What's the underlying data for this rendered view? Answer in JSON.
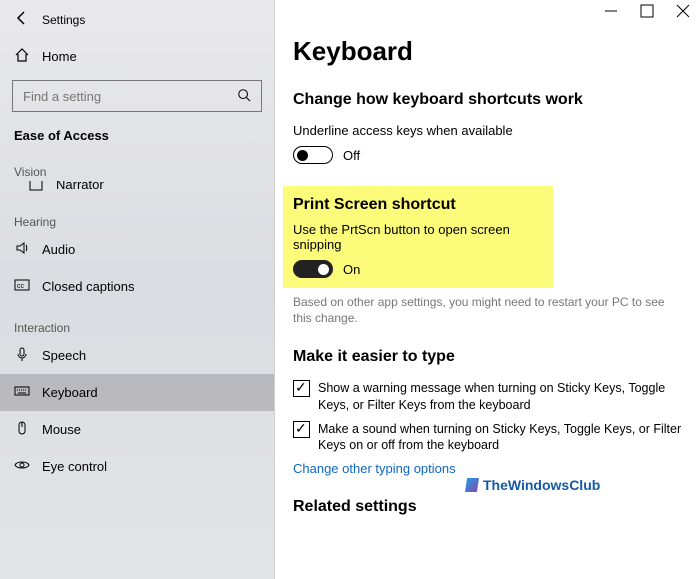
{
  "titlebar": {
    "label": "Settings"
  },
  "sidebar": {
    "home": "Home",
    "search_placeholder": "Find a setting",
    "current_category": "Ease of Access",
    "groups": [
      {
        "label": "Vision",
        "items": [
          {
            "icon": "narrator",
            "label": "Narrator",
            "id": "narrator"
          }
        ]
      },
      {
        "label": "Hearing",
        "items": [
          {
            "icon": "audio",
            "label": "Audio",
            "id": "audio"
          },
          {
            "icon": "cc",
            "label": "Closed captions",
            "id": "cc"
          }
        ]
      },
      {
        "label": "Interaction",
        "items": [
          {
            "icon": "speech",
            "label": "Speech",
            "id": "speech"
          },
          {
            "icon": "keyboard",
            "label": "Keyboard",
            "id": "keyboard",
            "selected": true
          },
          {
            "icon": "mouse",
            "label": "Mouse",
            "id": "mouse"
          },
          {
            "icon": "eye",
            "label": "Eye control",
            "id": "eye"
          }
        ]
      }
    ]
  },
  "main": {
    "title": "Keyboard",
    "section1": {
      "heading": "Change how keyboard shortcuts work",
      "sub": "Underline access keys when available",
      "toggle": {
        "on": false,
        "state": "Off"
      }
    },
    "section2": {
      "heading": "Print Screen shortcut",
      "sub": "Use the PrtScn button to open screen snipping",
      "toggle": {
        "on": true,
        "state": "On"
      },
      "hint": "Based on other app settings, you might need to restart your PC to see this change."
    },
    "section3": {
      "heading": "Make it easier to type",
      "cb1": {
        "checked": true,
        "label": "Show a warning message when turning on Sticky Keys, Toggle Keys, or Filter Keys from the keyboard"
      },
      "cb2": {
        "checked": true,
        "label": "Make a sound when turning on Sticky Keys, Toggle Keys, or Filter Keys on or off from the keyboard"
      },
      "link": "Change other typing options"
    },
    "section4": {
      "heading": "Related settings"
    },
    "watermark": "TheWindowsClub"
  }
}
